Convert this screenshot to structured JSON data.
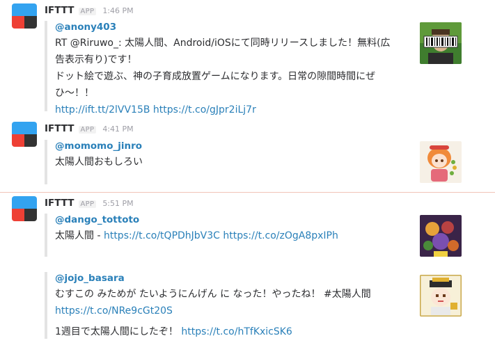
{
  "colors": {
    "link": "#2a80b9",
    "divider": "#f2c4b8",
    "ifttt_blue": "#33a3f0",
    "ifttt_red": "#ee4035",
    "ifttt_dark": "#333333"
  },
  "messages": [
    {
      "sender": "IFTTT",
      "badge": "APP",
      "time": "1:46 PM",
      "attachments": [
        {
          "author": "@anony403",
          "lines": [
            "RT @Riruwo_: 太陽人間、Android/iOSにて同時リリースしました！無料(広",
            "告表示有り)です！",
            "ドット絵で遊ぶ、神の子育成放置ゲームになります。日常の隙間時間にぜ",
            "ひ〜！！"
          ],
          "links": [
            "http://ift.tt/2lVV15B",
            "https://t.co/gJpr2iLj7r"
          ],
          "thumb_icon": "barcode-avatar-icon"
        }
      ]
    },
    {
      "sender": "IFTTT",
      "badge": "APP",
      "time": "4:41 PM",
      "attachments": [
        {
          "author": "@momomo_jinro",
          "lines": [
            "太陽人間おもしろい"
          ],
          "thumb_icon": "anime-girl-avatar-icon"
        }
      ]
    },
    {
      "sender": "IFTTT",
      "badge": "APP",
      "time": "5:51 PM",
      "attachments": [
        {
          "author": "@dango_tottoto",
          "prefix": "太陽人間 - ",
          "links": [
            "https://t.co/tQPDhJbV3C",
            "https://t.co/zOgA8pxIPh"
          ],
          "thumb_icon": "game-art-avatar-icon"
        },
        {
          "author": "@jojo_basara",
          "line": "むすこの みためが たいようにんげん に なった！やったね！ #太陽人間",
          "link1": "https://t.co/NRe9cGt20S",
          "line2": "1週目で太陽人間にしたぞ！ ",
          "link2": "https://t.co/hTfKxicSK6",
          "thumb_icon": "pixel-character-avatar-icon"
        }
      ]
    }
  ]
}
